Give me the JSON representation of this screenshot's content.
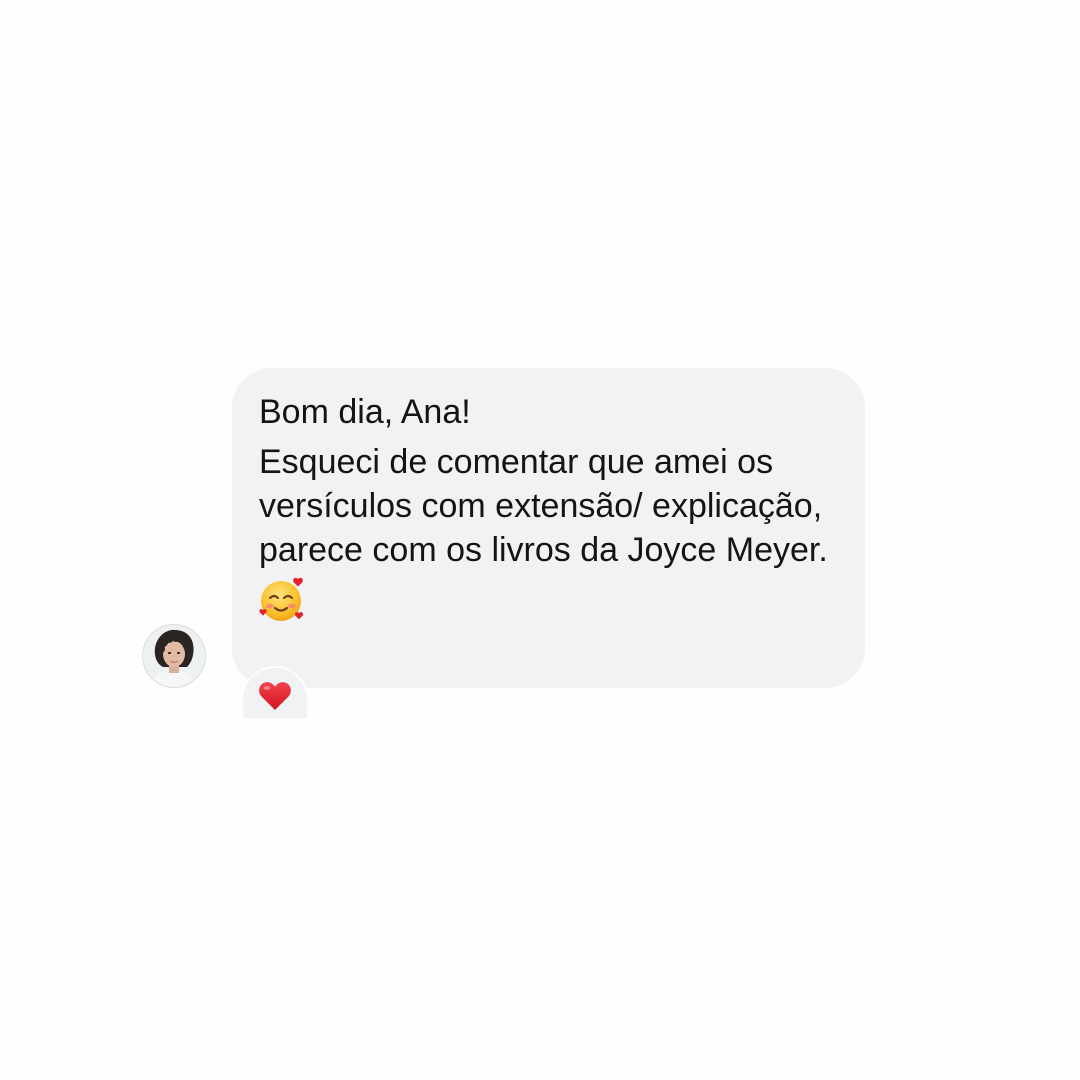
{
  "conversation": {
    "message": {
      "greeting": "Bom dia, Ana!",
      "body": "Esqueci de comentar que amei os versículos com extensão/ explicação, parece com os livros da Joyce Meyer.",
      "emoji": "smiling-face-with-hearts-icon",
      "reaction": "red-heart-icon"
    },
    "sender": {
      "avatar": "avatar"
    },
    "colors": {
      "bubble": "#f1f2f4",
      "text": "#141414",
      "background": "#fefefe",
      "heart": "#e4212f"
    }
  }
}
